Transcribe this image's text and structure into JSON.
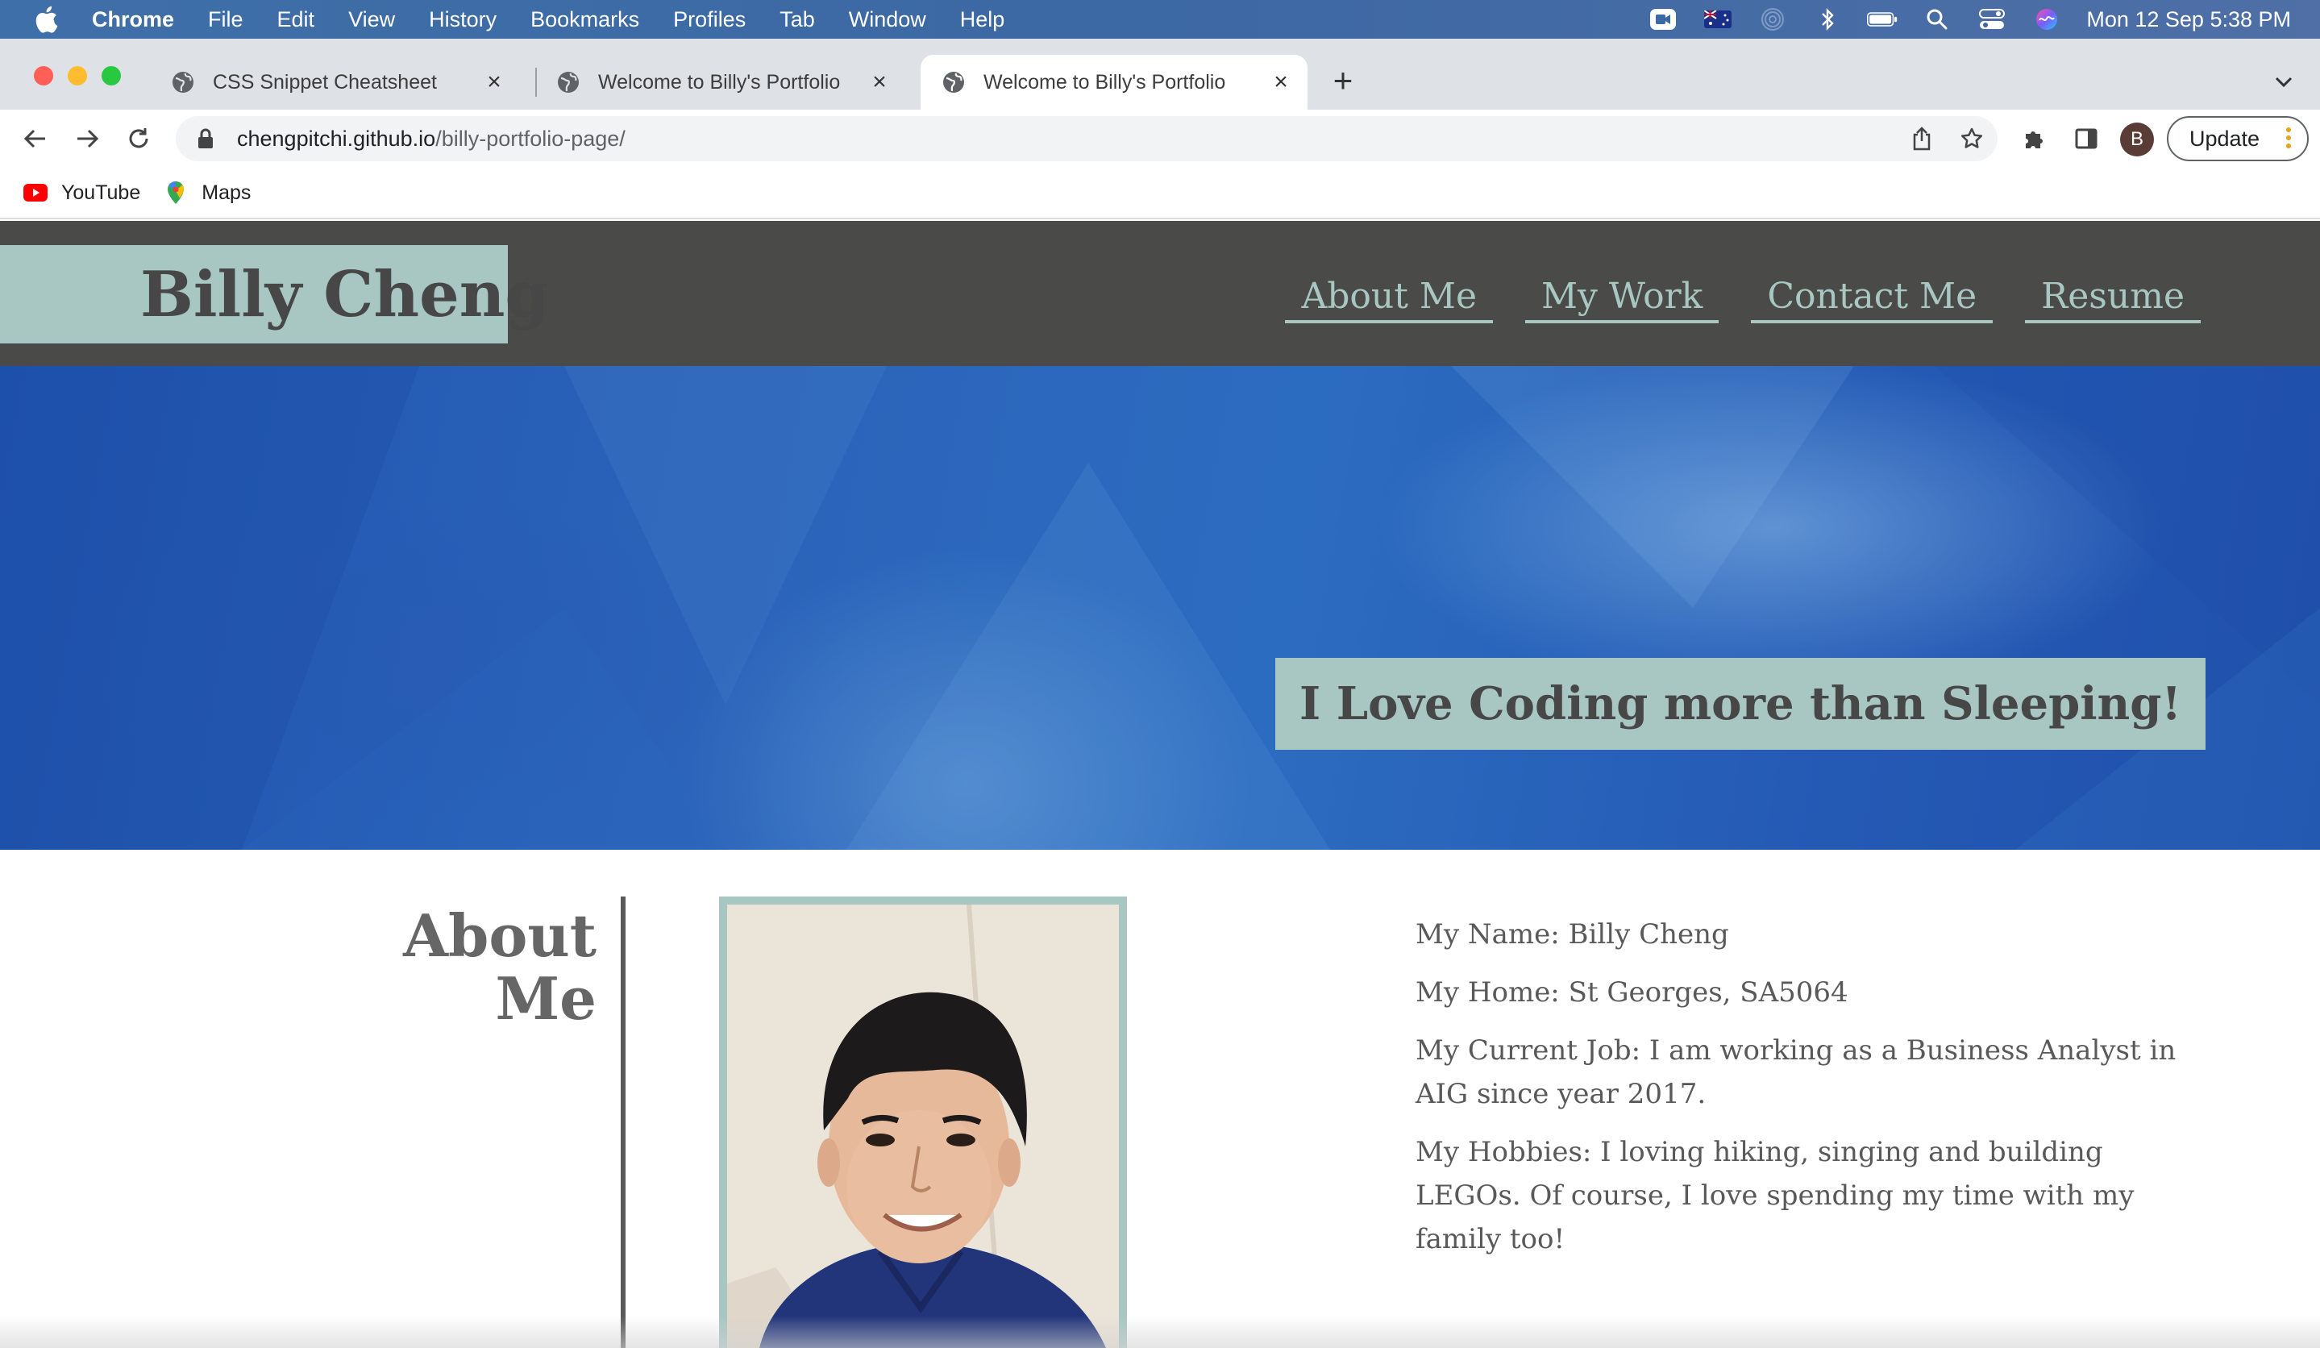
{
  "menubar": {
    "app_name": "Chrome",
    "items": [
      "File",
      "Edit",
      "View",
      "History",
      "Bookmarks",
      "Profiles",
      "Tab",
      "Window",
      "Help"
    ],
    "clock": "Mon 12 Sep  5:38 PM"
  },
  "tabs": [
    {
      "label": "CSS Snippet Cheatsheet",
      "active": false
    },
    {
      "label": "Welcome to Billy's Portfolio",
      "active": false
    },
    {
      "label": "Welcome to Billy's Portfolio",
      "active": true
    }
  ],
  "toolbar": {
    "url_host": "chengpitchi.github.io",
    "url_path": "/billy-portfolio-page/",
    "profile_initial": "B",
    "update_label": "Update"
  },
  "bookmarks": [
    {
      "label": "YouTube",
      "icon": "youtube-icon"
    },
    {
      "label": "Maps",
      "icon": "maps-icon"
    }
  ],
  "site": {
    "brand": "Billy Cheng",
    "nav": [
      "About Me",
      "My Work",
      "Contact Me",
      "Resume"
    ],
    "tagline": "I Love Coding more than Sleeping!",
    "about": {
      "heading_line1": "About",
      "heading_line2": "Me",
      "info": [
        "My Name: Billy Cheng",
        "My Home: St Georges, SA5064",
        "My Current Job: I am working as a Business Analyst in AIG since year 2017.",
        "My Hobbies: I loving hiking, singing and building LEGOs. Of course, I love spending my time with my family too!"
      ]
    }
  },
  "colors": {
    "accent": "#a8c7c2",
    "header_bg": "#4a4a48",
    "text_dark": "#474747",
    "hero_blue": "#2c6cc0"
  }
}
